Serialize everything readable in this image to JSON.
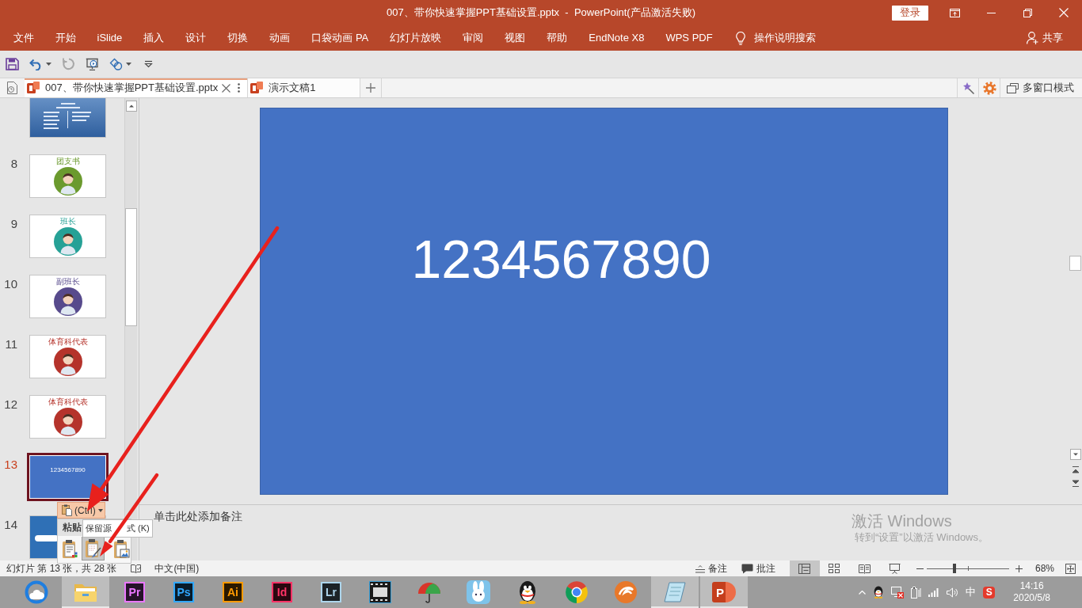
{
  "window": {
    "title": "007、带你快速掌握PPT基础设置.pptx  -  PowerPoint(产品激活失败)",
    "login_button": "登录"
  },
  "menu": [
    {
      "label": "文件"
    },
    {
      "label": "开始"
    },
    {
      "label": "iSlide"
    },
    {
      "label": "插入"
    },
    {
      "label": "设计"
    },
    {
      "label": "切换"
    },
    {
      "label": "动画"
    },
    {
      "label": "口袋动画 PA"
    },
    {
      "label": "幻灯片放映"
    },
    {
      "label": "审阅"
    },
    {
      "label": "视图"
    },
    {
      "label": "帮助"
    },
    {
      "label": "EndNote X8"
    },
    {
      "label": "WPS PDF"
    }
  ],
  "tell_me": "操作说明搜索",
  "share": "共享",
  "quick_access": [
    {
      "kind": "save",
      "disabled": false,
      "dropdown": false
    },
    {
      "kind": "undo",
      "disabled": false,
      "dropdown": true
    },
    {
      "kind": "redo",
      "disabled": true,
      "dropdown": false
    },
    {
      "kind": "present",
      "disabled": false,
      "dropdown": false
    },
    {
      "kind": "shapes",
      "disabled": false,
      "dropdown": true
    },
    {
      "kind": "customize",
      "disabled": false,
      "dropdown": false
    }
  ],
  "document_tabs": [
    {
      "label": "007、带你快速掌握PPT基础设置.pptx",
      "selected": true
    },
    {
      "label": "演示文稿1",
      "selected": false
    }
  ],
  "multi_window": "多窗口模式",
  "slides": [
    {
      "kind": "photo",
      "selected": false
    },
    {
      "number": "8",
      "kind": "avatar",
      "title": "团支书",
      "color": "#6b9a2e",
      "selected": false
    },
    {
      "number": "9",
      "kind": "avatar",
      "title": "班长",
      "color": "#26a196",
      "selected": false
    },
    {
      "number": "10",
      "kind": "avatar",
      "title": "副班长",
      "color": "#574a8c",
      "selected": false
    },
    {
      "number": "11",
      "kind": "avatar",
      "title": "体育科代表",
      "color": "#b5332b",
      "selected": false
    },
    {
      "number": "12",
      "kind": "avatar",
      "title": "体育科代表",
      "color": "#b5332b",
      "selected": false
    },
    {
      "number": "13",
      "kind": "text",
      "text": "1234567890",
      "selected": true
    },
    {
      "number": "14",
      "kind": "banner",
      "selected": false
    }
  ],
  "slide_text": "1234567890",
  "notes": {
    "placeholder": "单击此处添加备注"
  },
  "paste_options": {
    "button": "(Ctrl)",
    "heading": "粘贴",
    "tooltip": [
      "保留源",
      "式 (K)"
    ],
    "options": [
      {
        "kind": "theme",
        "selected": false
      },
      {
        "kind": "source",
        "selected": true
      },
      {
        "kind": "picture",
        "selected": false
      }
    ]
  },
  "activation": {
    "title": "激活 Windows",
    "message": "转到“设置”以激活 Windows。"
  },
  "status_bar": {
    "slide_info": "幻灯片 第 13 张，共 28 张",
    "language": "中文(中国)",
    "notes": "备注",
    "comments": "批注",
    "views": [
      {
        "kind": "normal",
        "selected": true
      },
      {
        "kind": "sorter",
        "selected": false
      },
      {
        "kind": "reading",
        "selected": false
      },
      {
        "kind": "slideshow",
        "selected": false
      }
    ],
    "zoom": {
      "level": 0.34,
      "reading": "68%"
    }
  },
  "taskbar": {
    "apps": [
      {
        "kind": "browser",
        "running": false
      },
      {
        "kind": "explorer",
        "running": true
      },
      {
        "kind": "adobe",
        "label": "Pr",
        "color": "#ea77ff",
        "running": false
      },
      {
        "kind": "adobe",
        "label": "Ps",
        "color": "#31a8ff",
        "running": false
      },
      {
        "kind": "adobe",
        "label": "Ai",
        "color": "#ff9a00",
        "running": false
      },
      {
        "kind": "adobe",
        "label": "Id",
        "color": "#ff3366",
        "running": false
      },
      {
        "kind": "adobe",
        "label": "Lr",
        "color": "#add5ec",
        "running": false
      },
      {
        "kind": "film",
        "running": false
      },
      {
        "kind": "umbrella",
        "running": false
      },
      {
        "kind": "rabbit",
        "running": false
      },
      {
        "kind": "penguin",
        "running": false
      },
      {
        "kind": "segmented",
        "running": false
      },
      {
        "kind": "swirl",
        "running": false
      },
      {
        "kind": "notepad",
        "running": true
      },
      {
        "kind": "powerpoint",
        "label": "P",
        "running": true
      }
    ],
    "tray": {
      "ime": "中",
      "input_method": "S",
      "time": "14:16",
      "date": "2020/5/8"
    }
  }
}
